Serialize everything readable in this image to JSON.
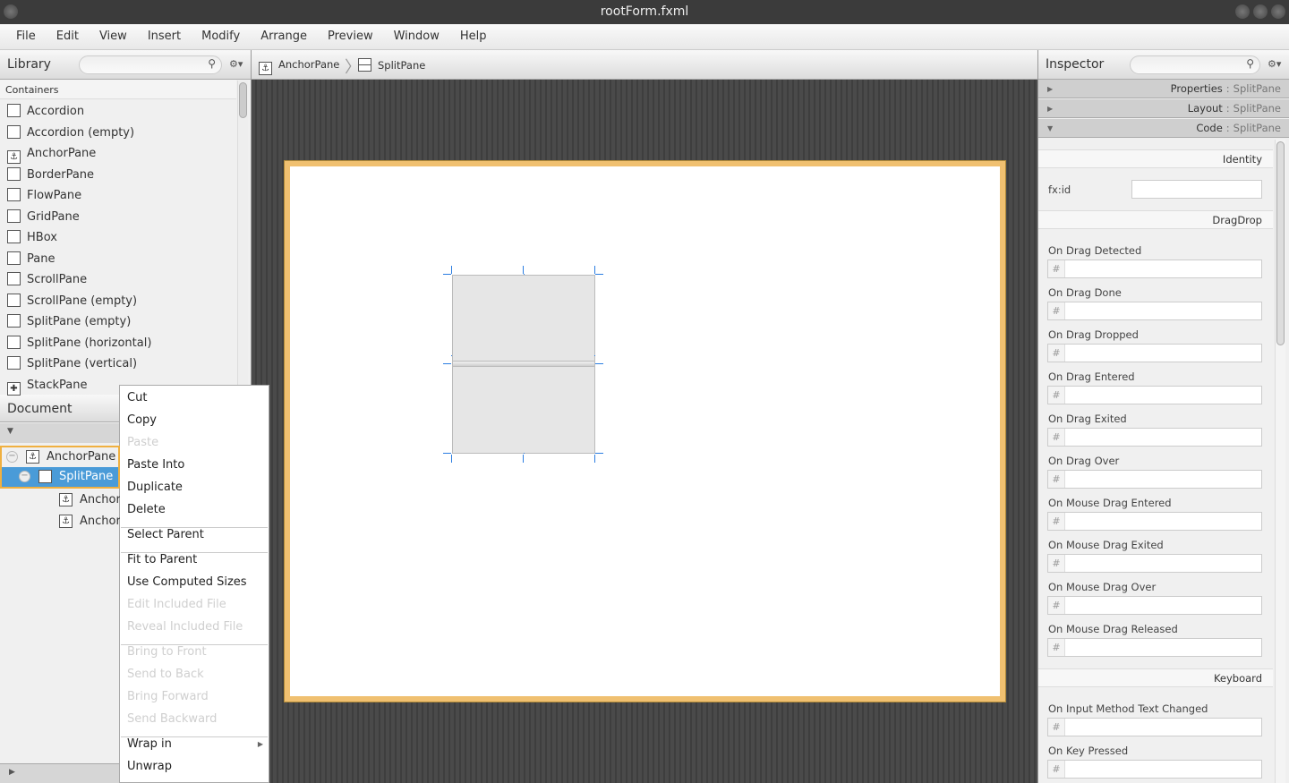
{
  "window": {
    "title": "rootForm.fxml"
  },
  "menubar": [
    "File",
    "Edit",
    "View",
    "Insert",
    "Modify",
    "Arrange",
    "Preview",
    "Window",
    "Help"
  ],
  "library": {
    "title": "Library",
    "search_placeholder": "",
    "section": "Containers",
    "items": [
      {
        "label": "Accordion",
        "icon": "accordion-icon"
      },
      {
        "label": "Accordion  (empty)",
        "icon": "accordion-icon"
      },
      {
        "label": "AnchorPane",
        "icon": "anchor-icon"
      },
      {
        "label": "BorderPane",
        "icon": "borderpane-icon"
      },
      {
        "label": "FlowPane",
        "icon": "flowpane-icon"
      },
      {
        "label": "GridPane",
        "icon": "gridpane-icon"
      },
      {
        "label": "HBox",
        "icon": "hbox-icon"
      },
      {
        "label": "Pane",
        "icon": "pane-icon"
      },
      {
        "label": "ScrollPane",
        "icon": "scrollpane-icon"
      },
      {
        "label": "ScrollPane  (empty)",
        "icon": "scrollpane-icon"
      },
      {
        "label": "SplitPane  (empty)",
        "icon": "splitpane-icon"
      },
      {
        "label": "SplitPane  (horizontal)",
        "icon": "splitpane-icon"
      },
      {
        "label": "SplitPane  (vertical)",
        "icon": "splitpane-icon"
      },
      {
        "label": "StackPane",
        "icon": "stackpane-icon"
      }
    ]
  },
  "document": {
    "title": "Document",
    "tree": [
      {
        "label": "AnchorPane",
        "level": 0
      },
      {
        "label": "SplitPane",
        "level": 1,
        "selected": true
      },
      {
        "label": "AnchorPane",
        "level": 2
      },
      {
        "label": "AnchorPane",
        "level": 2
      }
    ]
  },
  "breadcrumb": [
    "AnchorPane",
    "SplitPane"
  ],
  "context_menu": {
    "groups": [
      [
        {
          "label": "Cut",
          "enabled": true
        },
        {
          "label": "Copy",
          "enabled": true
        },
        {
          "label": "Paste",
          "enabled": false
        },
        {
          "label": "Paste Into",
          "enabled": true
        },
        {
          "label": "Duplicate",
          "enabled": true
        },
        {
          "label": "Delete",
          "enabled": true
        }
      ],
      [
        {
          "label": "Select Parent",
          "enabled": true
        }
      ],
      [
        {
          "label": "Fit to Parent",
          "enabled": true
        },
        {
          "label": "Use Computed Sizes",
          "enabled": true
        },
        {
          "label": "Edit Included File",
          "enabled": false
        },
        {
          "label": "Reveal Included File",
          "enabled": false
        }
      ],
      [
        {
          "label": "Bring to Front",
          "enabled": false
        },
        {
          "label": "Send to Back",
          "enabled": false
        },
        {
          "label": "Bring Forward",
          "enabled": false
        },
        {
          "label": "Send Backward",
          "enabled": false
        }
      ],
      [
        {
          "label": "Wrap in",
          "enabled": true,
          "submenu": true
        },
        {
          "label": "Unwrap",
          "enabled": true
        }
      ]
    ]
  },
  "inspector": {
    "title": "Inspector",
    "search_placeholder": "",
    "sections": [
      {
        "label": "Properties",
        "target": "SplitPane",
        "expanded": false
      },
      {
        "label": "Layout",
        "target": "SplitPane",
        "expanded": false
      },
      {
        "label": "Code",
        "target": "SplitPane",
        "expanded": true
      }
    ],
    "identity_header": "Identity",
    "fxid_label": "fx:id",
    "fxid_value": "",
    "dragdrop_header": "DragDrop",
    "dragdrop_events": [
      "On Drag Detected",
      "On Drag Done",
      "On Drag Dropped",
      "On Drag Entered",
      "On Drag Exited",
      "On Drag Over",
      "On Mouse Drag Entered",
      "On Mouse Drag Exited",
      "On Mouse Drag Over",
      "On Mouse Drag Released"
    ],
    "keyboard_header": "Keyboard",
    "keyboard_events": [
      "On Input Method Text Changed",
      "On Key Pressed"
    ],
    "hash": "#",
    "separator": ":"
  },
  "colors": {
    "selection": "#4a9bd8",
    "canvas_border": "#f0c070",
    "handle": "#2a7de1"
  }
}
